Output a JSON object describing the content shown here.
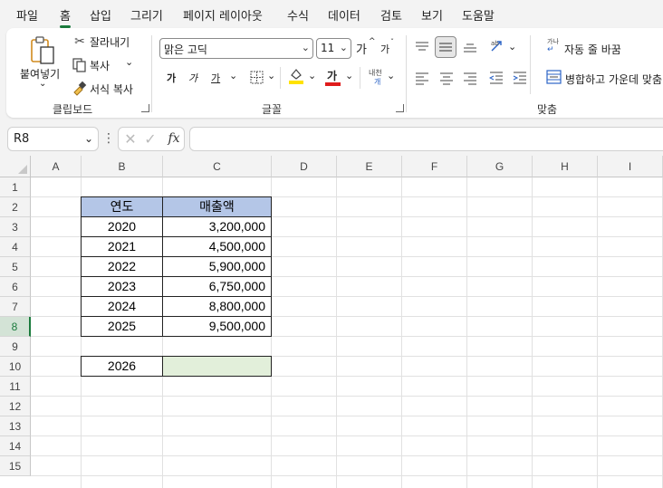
{
  "menu": {
    "tabs": [
      "파일",
      "홈",
      "삽입",
      "그리기",
      "페이지 레이아웃",
      "수식",
      "데이터",
      "검토",
      "보기",
      "도움말"
    ],
    "active": "홈"
  },
  "ribbon": {
    "clipboard": {
      "paste_label": "붙여넣기",
      "cut_label": "잘라내기",
      "copy_label": "복사",
      "format_painter_label": "서식 복사",
      "group_label": "클립보드"
    },
    "font": {
      "font_name": "맑은 고딕",
      "font_size": "11",
      "grow_label": "가",
      "shrink_label": "가",
      "bold_label": "가",
      "italic_label": "가",
      "underline_label": "가",
      "font_color_label": "가",
      "phonetic_label": "내천",
      "group_label": "글꼴"
    },
    "alignment": {
      "wrap_text_label": "자동 줄 바꿈",
      "merge_label": "병합하고 가운데 맞춤",
      "group_label": "맞춤"
    }
  },
  "formula_bar": {
    "name_box": "R8",
    "formula": ""
  },
  "sheet": {
    "columns": [
      "A",
      "B",
      "C",
      "D",
      "E",
      "F",
      "G",
      "H",
      "I"
    ],
    "rows": [
      "1",
      "2",
      "3",
      "4",
      "5",
      "6",
      "7",
      "8",
      "9",
      "10",
      "11",
      "12",
      "13",
      "14",
      "15"
    ],
    "selected_row": "8",
    "table": {
      "headers": [
        "연도",
        "매출액"
      ],
      "rows": [
        [
          "2020",
          "3,200,000"
        ],
        [
          "2021",
          "4,500,000"
        ],
        [
          "2022",
          "5,900,000"
        ],
        [
          "2023",
          "6,750,000"
        ],
        [
          "2024",
          "8,800,000"
        ],
        [
          "2025",
          "9,500,000"
        ]
      ]
    },
    "forecast": {
      "year": "2026",
      "value": ""
    }
  },
  "colors": {
    "accent": "#1a7a3c",
    "header_fill": "#b4c6e7",
    "forecast_fill": "#e2efda"
  }
}
